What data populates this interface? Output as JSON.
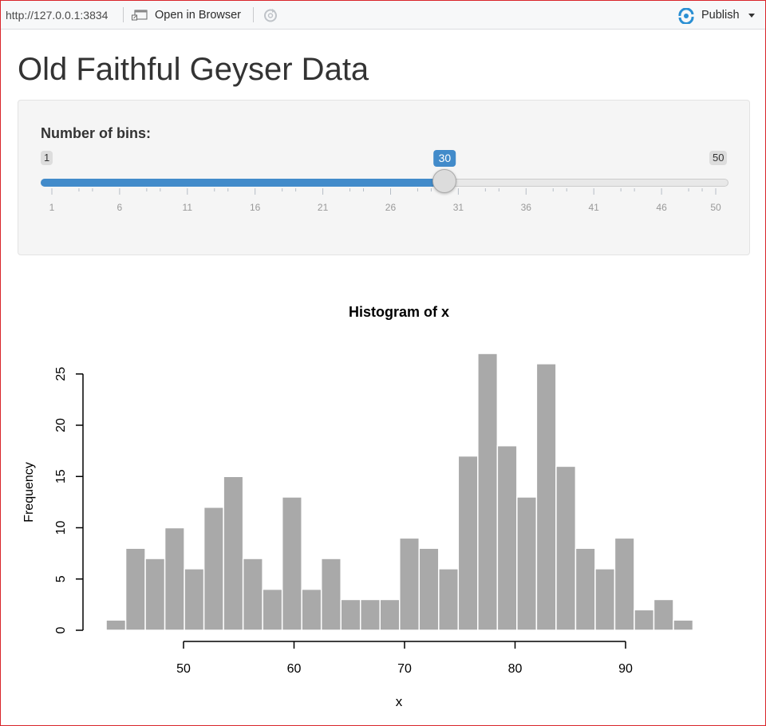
{
  "toolbar": {
    "url": "http://127.0.0.1:3834",
    "open_label": "Open in Browser",
    "publish_label": "Publish"
  },
  "page": {
    "title": "Old Faithful Geyser Data"
  },
  "slider": {
    "label": "Number of bins:",
    "min": 1,
    "max": 50,
    "value": 30,
    "min_label": "1",
    "max_label": "50",
    "value_label": "30",
    "tick_labels": [
      "1",
      "6",
      "11",
      "16",
      "21",
      "26",
      "31",
      "36",
      "41",
      "46",
      "50"
    ]
  },
  "colors": {
    "accent": "#428bca",
    "bar_fill": "#a9a9a9"
  },
  "chart_data": {
    "type": "bar",
    "title": "Histogram of x",
    "xlabel": "x",
    "ylabel": "Frequency",
    "bin_width": 1.77,
    "bin_start": 43,
    "values": [
      1,
      8,
      7,
      10,
      6,
      12,
      15,
      7,
      4,
      13,
      4,
      7,
      3,
      3,
      3,
      9,
      8,
      6,
      17,
      27,
      18,
      13,
      26,
      16,
      8,
      6,
      9,
      2,
      3,
      1
    ],
    "x_ticks": [
      50,
      60,
      70,
      80,
      90
    ],
    "x_tick_labels": [
      "50",
      "60",
      "70",
      "80",
      "90"
    ],
    "y_ticks": [
      0,
      5,
      10,
      15,
      20,
      25
    ],
    "y_tick_labels": [
      "0",
      "5",
      "10",
      "15",
      "20",
      "25"
    ],
    "xlim": [
      43,
      96.1
    ],
    "ylim": [
      0,
      27
    ]
  }
}
